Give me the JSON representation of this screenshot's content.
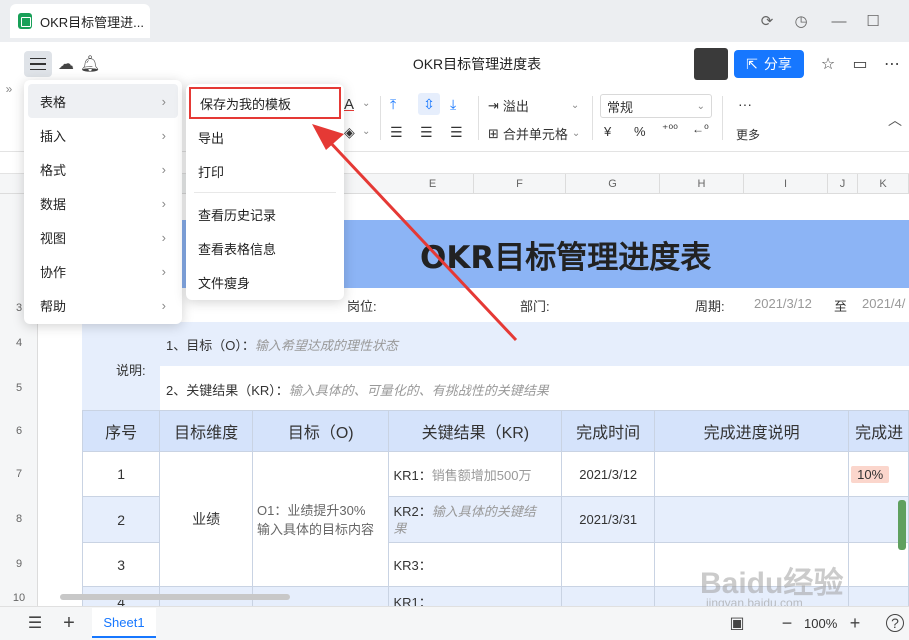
{
  "window": {
    "tab_title": "OKR目标管理进..."
  },
  "header": {
    "doc_title": "OKR目标管理进度表",
    "share_label": "分享"
  },
  "toolbar": {
    "overflow_label": "溢出",
    "merge_label": "合并单元格",
    "number_format": "常规",
    "more_label": "更多",
    "more_dots": "···",
    "font_color_glyph": "A",
    "currency_glyph": "¥",
    "percent_glyph": "%"
  },
  "columns": [
    "E",
    "F",
    "G",
    "H",
    "I",
    "J",
    "K"
  ],
  "rows": [
    "3",
    "4",
    "5",
    "6",
    "7",
    "8",
    "9",
    "10"
  ],
  "sheet": {
    "title": "OKR目标管理进度表",
    "post_label": "岗位:",
    "dept_label": "部门:",
    "period_label": "周期:",
    "period_start": "2021/3/12",
    "period_to": "至",
    "period_end": "2021/4/",
    "desc_label": "说明:",
    "desc_line1_prefix": "1、目标（O）：",
    "desc_line1_hint": "输入希望达成的理性状态",
    "desc_line2_prefix": "2、关键结果（KR）：",
    "desc_line2_hint": "输入具体的、可量化的、有挑战性的关键结果"
  },
  "table": {
    "headers": [
      "序号",
      "目标维度",
      "目标（O)",
      "关键结果（KR)",
      "完成时间",
      "完成进度说明",
      "完成进"
    ],
    "rows": [
      {
        "no": "1",
        "kr_prefix": "KR1：",
        "kr_text": "销售额增加500万",
        "date": "2021/3/12",
        "progress": "10%"
      },
      {
        "no": "2",
        "kr_prefix": "KR2：",
        "kr_text": "输入具体的关键结",
        "kr_text2": "果",
        "date": "2021/3/31"
      },
      {
        "no": "3",
        "kr_prefix": "KR3："
      },
      {
        "no": "4",
        "kr_prefix": "KR1："
      }
    ],
    "dimension": "业绩",
    "objective_line1": "O1：业绩提升30%",
    "objective_line2": "输入具体的目标内容"
  },
  "main_menu": {
    "items": [
      {
        "label": "表格"
      },
      {
        "label": "插入"
      },
      {
        "label": "格式"
      },
      {
        "label": "数据"
      },
      {
        "label": "视图"
      },
      {
        "label": "协作"
      },
      {
        "label": "帮助"
      }
    ]
  },
  "sub_menu": {
    "items": [
      {
        "label": "保存为我的模板"
      },
      {
        "label": "导出"
      },
      {
        "label": "打印"
      },
      {
        "label": "查看历史记录"
      },
      {
        "label": "查看表格信息"
      },
      {
        "label": "文件瘦身"
      }
    ]
  },
  "bottom": {
    "sheet_tab": "Sheet1",
    "zoom": "100%"
  },
  "watermark": {
    "brand": "Baidu经验",
    "url": "jingyan.baidu.com"
  },
  "colors": {
    "accent": "#1677ff",
    "title_band": "#8cb4f5",
    "arrow": "#e53935"
  }
}
